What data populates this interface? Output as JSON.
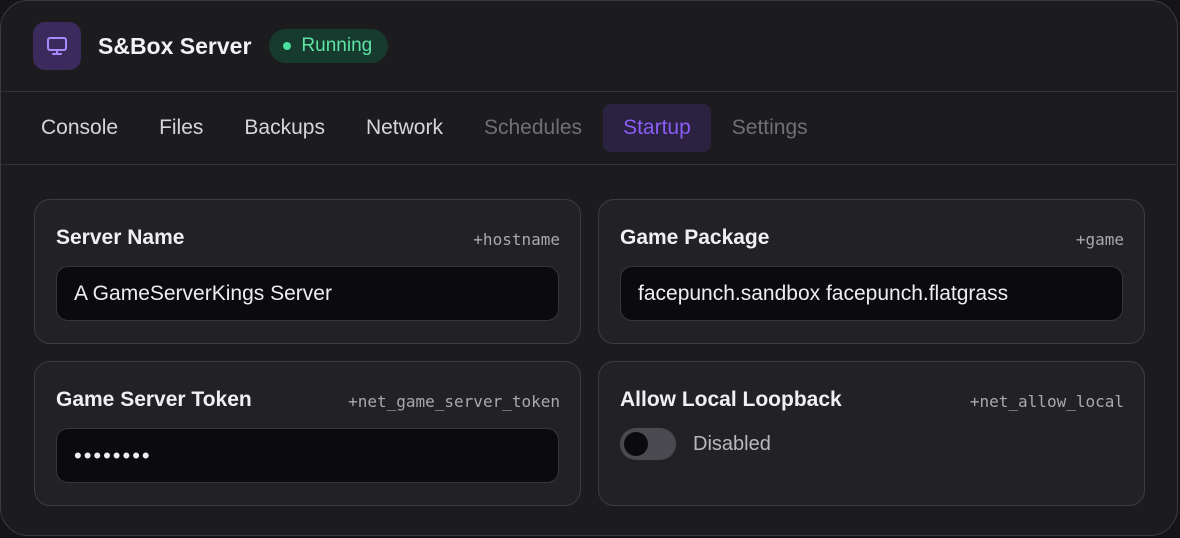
{
  "header": {
    "title": "S&Box Server",
    "status": "Running",
    "icon": "monitor-icon"
  },
  "tabs": [
    {
      "label": "Console",
      "state": "normal"
    },
    {
      "label": "Files",
      "state": "normal"
    },
    {
      "label": "Backups",
      "state": "normal"
    },
    {
      "label": "Network",
      "state": "normal"
    },
    {
      "label": "Schedules",
      "state": "disabled"
    },
    {
      "label": "Startup",
      "state": "active"
    },
    {
      "label": "Settings",
      "state": "disabled"
    }
  ],
  "startup": {
    "server_name": {
      "label": "Server Name",
      "var": "+hostname",
      "value": "A GameServerKings Server"
    },
    "game_package": {
      "label": "Game Package",
      "var": "+game",
      "value": "facepunch.sandbox facepunch.flatgrass"
    },
    "game_server_token": {
      "label": "Game Server Token",
      "var": "+net_game_server_token",
      "value": "••••••••"
    },
    "allow_local_loopback": {
      "label": "Allow Local Loopback",
      "var": "+net_allow_local",
      "enabled": false,
      "state_label": "Disabled"
    }
  },
  "colors": {
    "accent": "#8b5cf6",
    "status_green": "#5ee3a4",
    "background": "#1c1c1f"
  }
}
